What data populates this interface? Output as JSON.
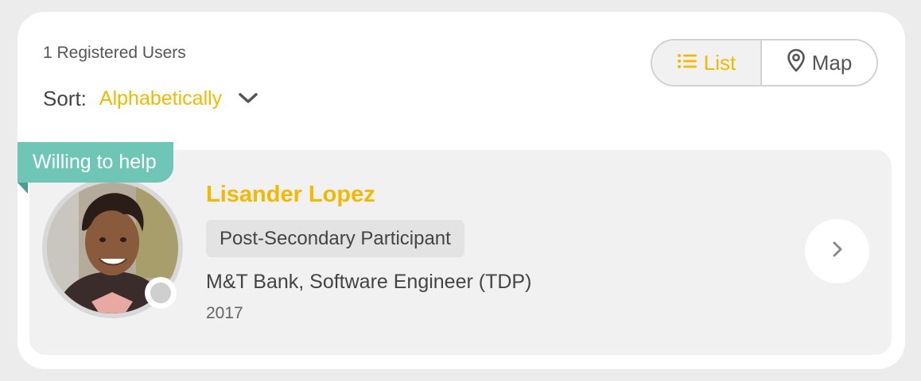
{
  "header": {
    "registered_count": "1 Registered Users",
    "sort_label": "Sort:",
    "sort_value": "Alphabetically"
  },
  "view_toggle": {
    "list_label": "List",
    "map_label": "Map",
    "active": "list"
  },
  "users": [
    {
      "tag": "Willing to help",
      "name": "Lisander Lopez",
      "role": "Post-Secondary Participant",
      "employer": "M&T Bank, Software Engineer (TDP)",
      "year": "2017",
      "status": "offline"
    }
  ],
  "icons": {
    "sort": "chevron-down-icon",
    "list": "list-icon",
    "map": "map-pin-icon",
    "next": "chevron-right-icon"
  },
  "colors": {
    "accent": "#f5b800",
    "tag": "#6fc5b6",
    "card": "#f1f1f1"
  }
}
